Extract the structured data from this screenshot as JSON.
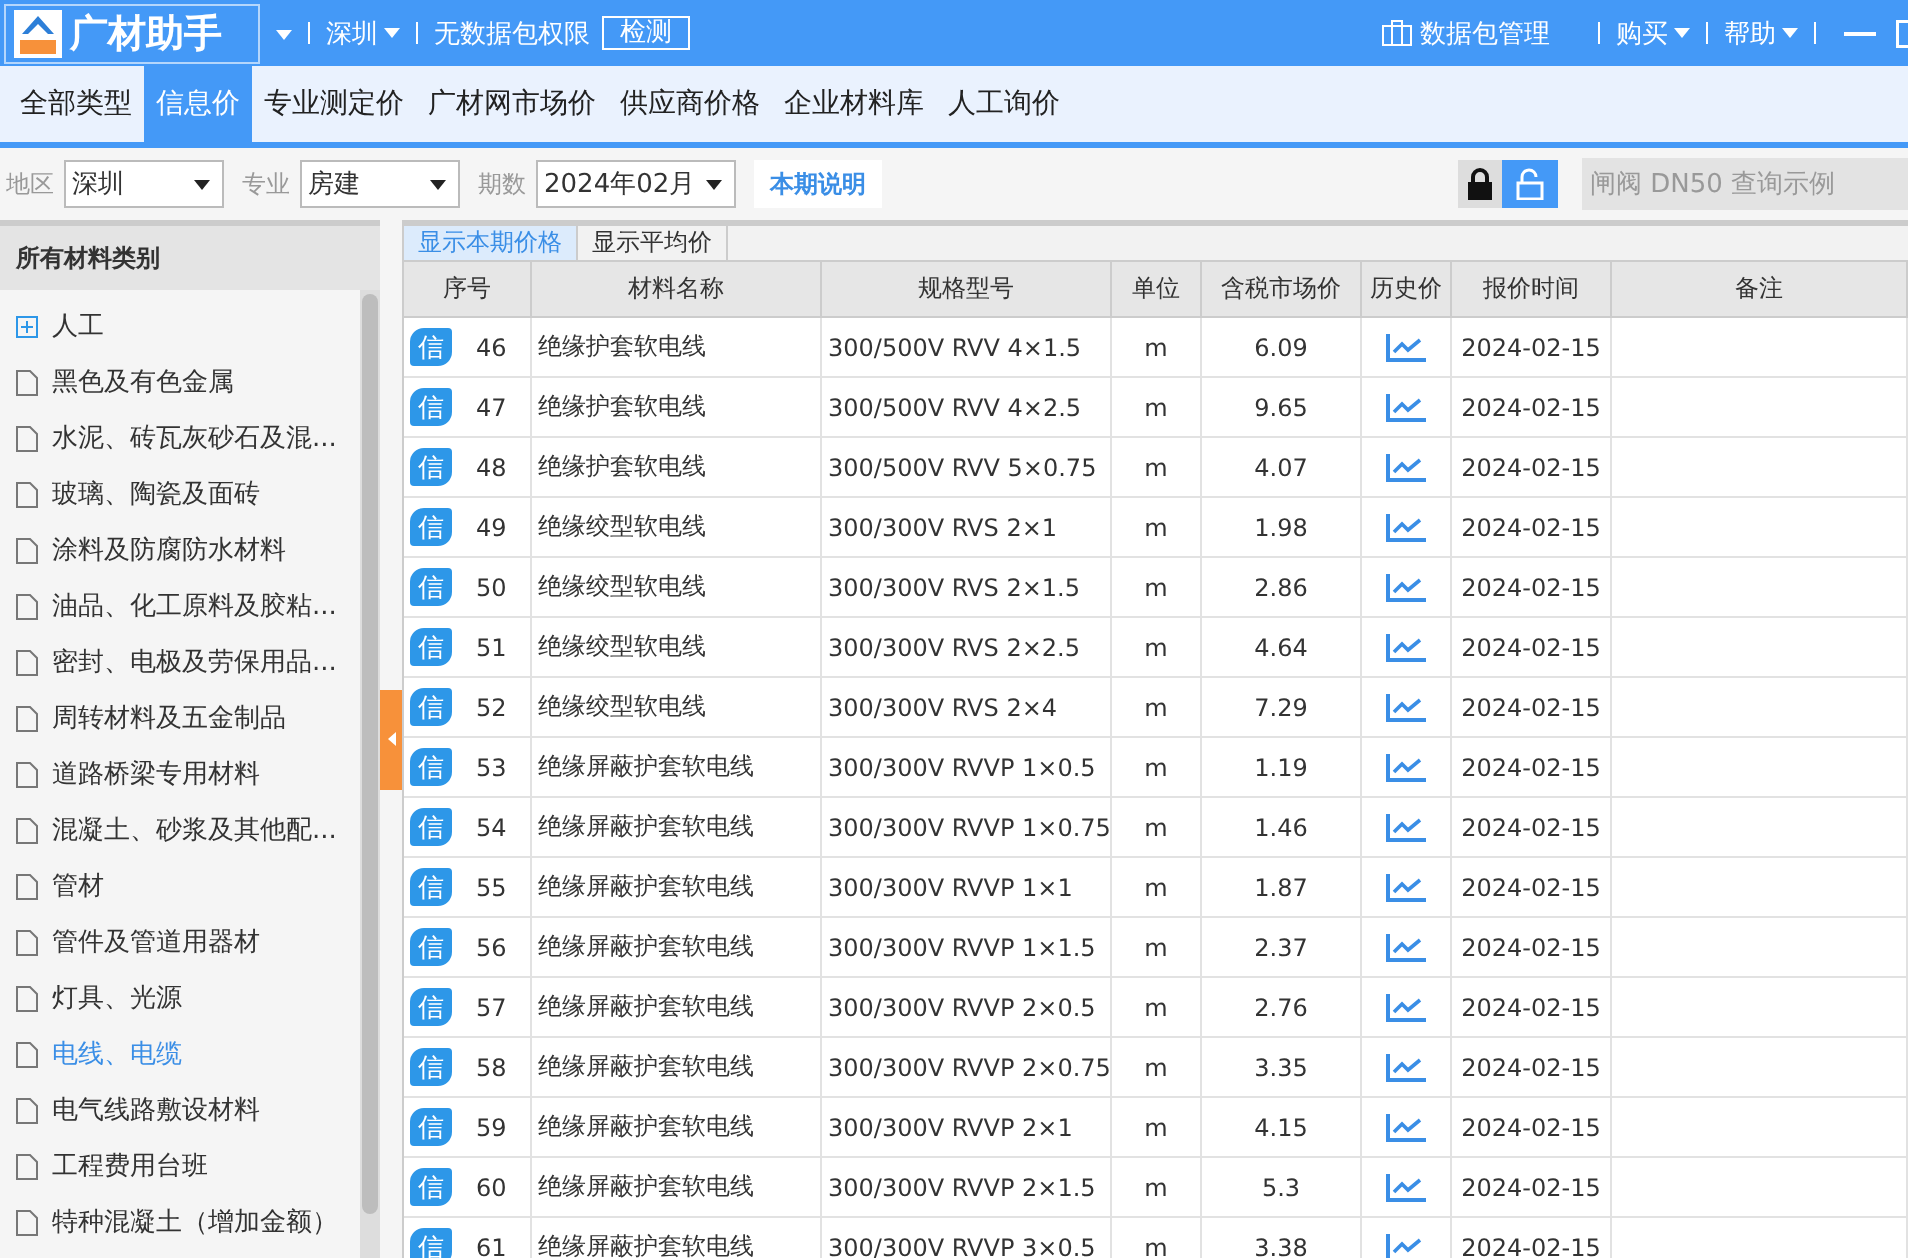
{
  "title_bar": {
    "app_name": "广材助手",
    "city": "深圳",
    "permission_text": "无数据包权限",
    "check_button": "检测",
    "package_manage": "数据包管理",
    "buy": "购买",
    "help": "帮助"
  },
  "nav_tabs": [
    {
      "label": "全部类型",
      "selected": false
    },
    {
      "label": "信息价",
      "selected": true
    },
    {
      "label": "专业测定价",
      "selected": false
    },
    {
      "label": "广材网市场价",
      "selected": false
    },
    {
      "label": "供应商价格",
      "selected": false
    },
    {
      "label": "企业材料库",
      "selected": false
    },
    {
      "label": "人工询价",
      "selected": false
    }
  ],
  "filters": [
    {
      "label": "地区",
      "value": "深圳"
    },
    {
      "label": "专业",
      "value": "房建"
    },
    {
      "label": "期数",
      "value": "2024年02月"
    }
  ],
  "period_note_button": "本期说明",
  "lock": {
    "locked": false
  },
  "search": {
    "placeholder": "闸阀 DN50 查询示例"
  },
  "sidebar": {
    "title": "所有材料类别",
    "items": [
      {
        "label": "人工",
        "kind": "group",
        "selected": false
      },
      {
        "label": "黑色及有色金属",
        "kind": "leaf",
        "selected": false
      },
      {
        "label": "水泥、砖瓦灰砂石及混...",
        "kind": "leaf",
        "selected": false
      },
      {
        "label": "玻璃、陶瓷及面砖",
        "kind": "leaf",
        "selected": false
      },
      {
        "label": "涂料及防腐防水材料",
        "kind": "leaf",
        "selected": false
      },
      {
        "label": "油品、化工原料及胶粘...",
        "kind": "leaf",
        "selected": false
      },
      {
        "label": "密封、电极及劳保用品...",
        "kind": "leaf",
        "selected": false
      },
      {
        "label": "周转材料及五金制品",
        "kind": "leaf",
        "selected": false
      },
      {
        "label": "道路桥梁专用材料",
        "kind": "leaf",
        "selected": false
      },
      {
        "label": "混凝土、砂浆及其他配...",
        "kind": "leaf",
        "selected": false
      },
      {
        "label": "管材",
        "kind": "leaf",
        "selected": false
      },
      {
        "label": "管件及管道用器材",
        "kind": "leaf",
        "selected": false
      },
      {
        "label": "灯具、光源",
        "kind": "leaf",
        "selected": false
      },
      {
        "label": "电线、电缆",
        "kind": "leaf",
        "selected": true
      },
      {
        "label": "电气线路敷设材料",
        "kind": "leaf",
        "selected": false
      },
      {
        "label": "工程费用台班",
        "kind": "leaf",
        "selected": false
      },
      {
        "label": "特种混凝土（增加金额）",
        "kind": "leaf",
        "selected": false
      }
    ]
  },
  "price_tabs": [
    {
      "label": "显示本期价格",
      "selected": true
    },
    {
      "label": "显示平均价",
      "selected": false
    }
  ],
  "table": {
    "columns": [
      "序号",
      "材料名称",
      "规格型号",
      "单位",
      "含税市场价",
      "历史价",
      "报价时间",
      "备注"
    ],
    "rows": [
      {
        "badge": "信",
        "no": "46",
        "name": "绝缘护套软电线",
        "spec": "300/500V RVV 4×1.5",
        "unit": "m",
        "price": "6.09",
        "date": "2024-02-15"
      },
      {
        "badge": "信",
        "no": "47",
        "name": "绝缘护套软电线",
        "spec": "300/500V RVV 4×2.5",
        "unit": "m",
        "price": "9.65",
        "date": "2024-02-15"
      },
      {
        "badge": "信",
        "no": "48",
        "name": "绝缘护套软电线",
        "spec": "300/500V RVV 5×0.75",
        "unit": "m",
        "price": "4.07",
        "date": "2024-02-15"
      },
      {
        "badge": "信",
        "no": "49",
        "name": "绝缘绞型软电线",
        "spec": "300/300V RVS 2×1",
        "unit": "m",
        "price": "1.98",
        "date": "2024-02-15"
      },
      {
        "badge": "信",
        "no": "50",
        "name": "绝缘绞型软电线",
        "spec": "300/300V RVS 2×1.5",
        "unit": "m",
        "price": "2.86",
        "date": "2024-02-15"
      },
      {
        "badge": "信",
        "no": "51",
        "name": "绝缘绞型软电线",
        "spec": "300/300V RVS 2×2.5",
        "unit": "m",
        "price": "4.64",
        "date": "2024-02-15"
      },
      {
        "badge": "信",
        "no": "52",
        "name": "绝缘绞型软电线",
        "spec": "300/300V RVS 2×4",
        "unit": "m",
        "price": "7.29",
        "date": "2024-02-15"
      },
      {
        "badge": "信",
        "no": "53",
        "name": "绝缘屏蔽护套软电线",
        "spec": "300/300V RVVP 1×0.5",
        "unit": "m",
        "price": "1.19",
        "date": "2024-02-15"
      },
      {
        "badge": "信",
        "no": "54",
        "name": "绝缘屏蔽护套软电线",
        "spec": "300/300V RVVP 1×0.75",
        "unit": "m",
        "price": "1.46",
        "date": "2024-02-15"
      },
      {
        "badge": "信",
        "no": "55",
        "name": "绝缘屏蔽护套软电线",
        "spec": "300/300V RVVP 1×1",
        "unit": "m",
        "price": "1.87",
        "date": "2024-02-15"
      },
      {
        "badge": "信",
        "no": "56",
        "name": "绝缘屏蔽护套软电线",
        "spec": "300/300V RVVP 1×1.5",
        "unit": "m",
        "price": "2.37",
        "date": "2024-02-15"
      },
      {
        "badge": "信",
        "no": "57",
        "name": "绝缘屏蔽护套软电线",
        "spec": "300/300V RVVP 2×0.5",
        "unit": "m",
        "price": "2.76",
        "date": "2024-02-15"
      },
      {
        "badge": "信",
        "no": "58",
        "name": "绝缘屏蔽护套软电线",
        "spec": "300/300V RVVP 2×0.75",
        "unit": "m",
        "price": "3.35",
        "date": "2024-02-15"
      },
      {
        "badge": "信",
        "no": "59",
        "name": "绝缘屏蔽护套软电线",
        "spec": "300/300V RVVP 2×1",
        "unit": "m",
        "price": "4.15",
        "date": "2024-02-15"
      },
      {
        "badge": "信",
        "no": "60",
        "name": "绝缘屏蔽护套软电线",
        "spec": "300/300V RVVP 2×1.5",
        "unit": "m",
        "price": "5.3",
        "date": "2024-02-15"
      },
      {
        "badge": "信",
        "no": "61",
        "name": "绝缘屏蔽护套软电线",
        "spec": "300/300V RVVP 3×0.5",
        "unit": "m",
        "price": "3.38",
        "date": "2024-02-15"
      }
    ]
  }
}
